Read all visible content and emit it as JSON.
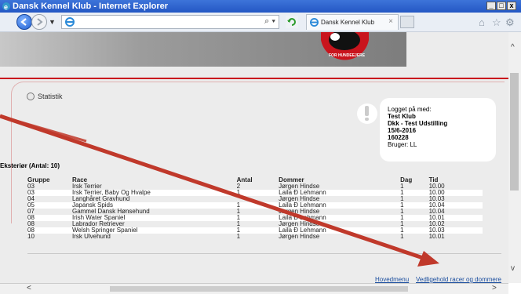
{
  "window": {
    "title": "Dansk Kennel Klub - Internet Explorer",
    "min": "_",
    "max": "□",
    "close": "x"
  },
  "browser": {
    "tab_title": "Dansk Kennel Klub",
    "tab_close": "×",
    "addr_controls": "⌕ ▾"
  },
  "page": {
    "stat_link": "Statistik",
    "info": {
      "line1": "Logget på med:",
      "line2": "Test Klub",
      "line3": "Dkk - Test Udstilling",
      "line4": "15/6-2016",
      "line5": "160228",
      "line6": "Bruger: LL"
    },
    "section_title": "Eksteriør (Antal: 10)",
    "table": {
      "headers": [
        "Gruppe",
        "Race",
        "Antal",
        "Dommer",
        "Dag",
        "Tid"
      ],
      "rows": [
        [
          "03",
          "Irsk Terrier",
          "2",
          "Jørgen Hindse",
          "1",
          "10.00"
        ],
        [
          "03",
          "Irsk Terrier, Baby Og Hvalpe",
          "1",
          "Laila Ð Lehmann",
          "1",
          "10.00"
        ],
        [
          "04",
          "Langhåret Gravhund",
          "",
          "Jørgen Hindse",
          "1",
          "10.03"
        ],
        [
          "05",
          "Japansk Spids",
          "1",
          "Laila Ð Lehmann",
          "1",
          "10.04"
        ],
        [
          "07",
          "Gammel Dansk Hønsehund",
          "1",
          "Jørgen Hindse",
          "1",
          "10.04"
        ],
        [
          "08",
          "Irish Water Spaniel",
          "1",
          "Laila Ð Lehmann",
          "1",
          "10.01"
        ],
        [
          "08",
          "Labrador Retriever",
          "1",
          "Jørgen Hindse",
          "1",
          "10.02"
        ],
        [
          "08",
          "Welsh Springer Spaniel",
          "1",
          "Laila Ð Lehmann",
          "1",
          "10.03"
        ],
        [
          "10",
          "Irsk Ulvehund",
          "1",
          "Jørgen Hindse",
          "1",
          "10.01"
        ]
      ]
    },
    "footer": {
      "link1": "Hovedmenu",
      "link2": "Vedligehold racer og dommere"
    }
  },
  "colors": {
    "accent_red": "#c9141d",
    "arrow": "#c0392b",
    "link": "#1a4d9e"
  }
}
